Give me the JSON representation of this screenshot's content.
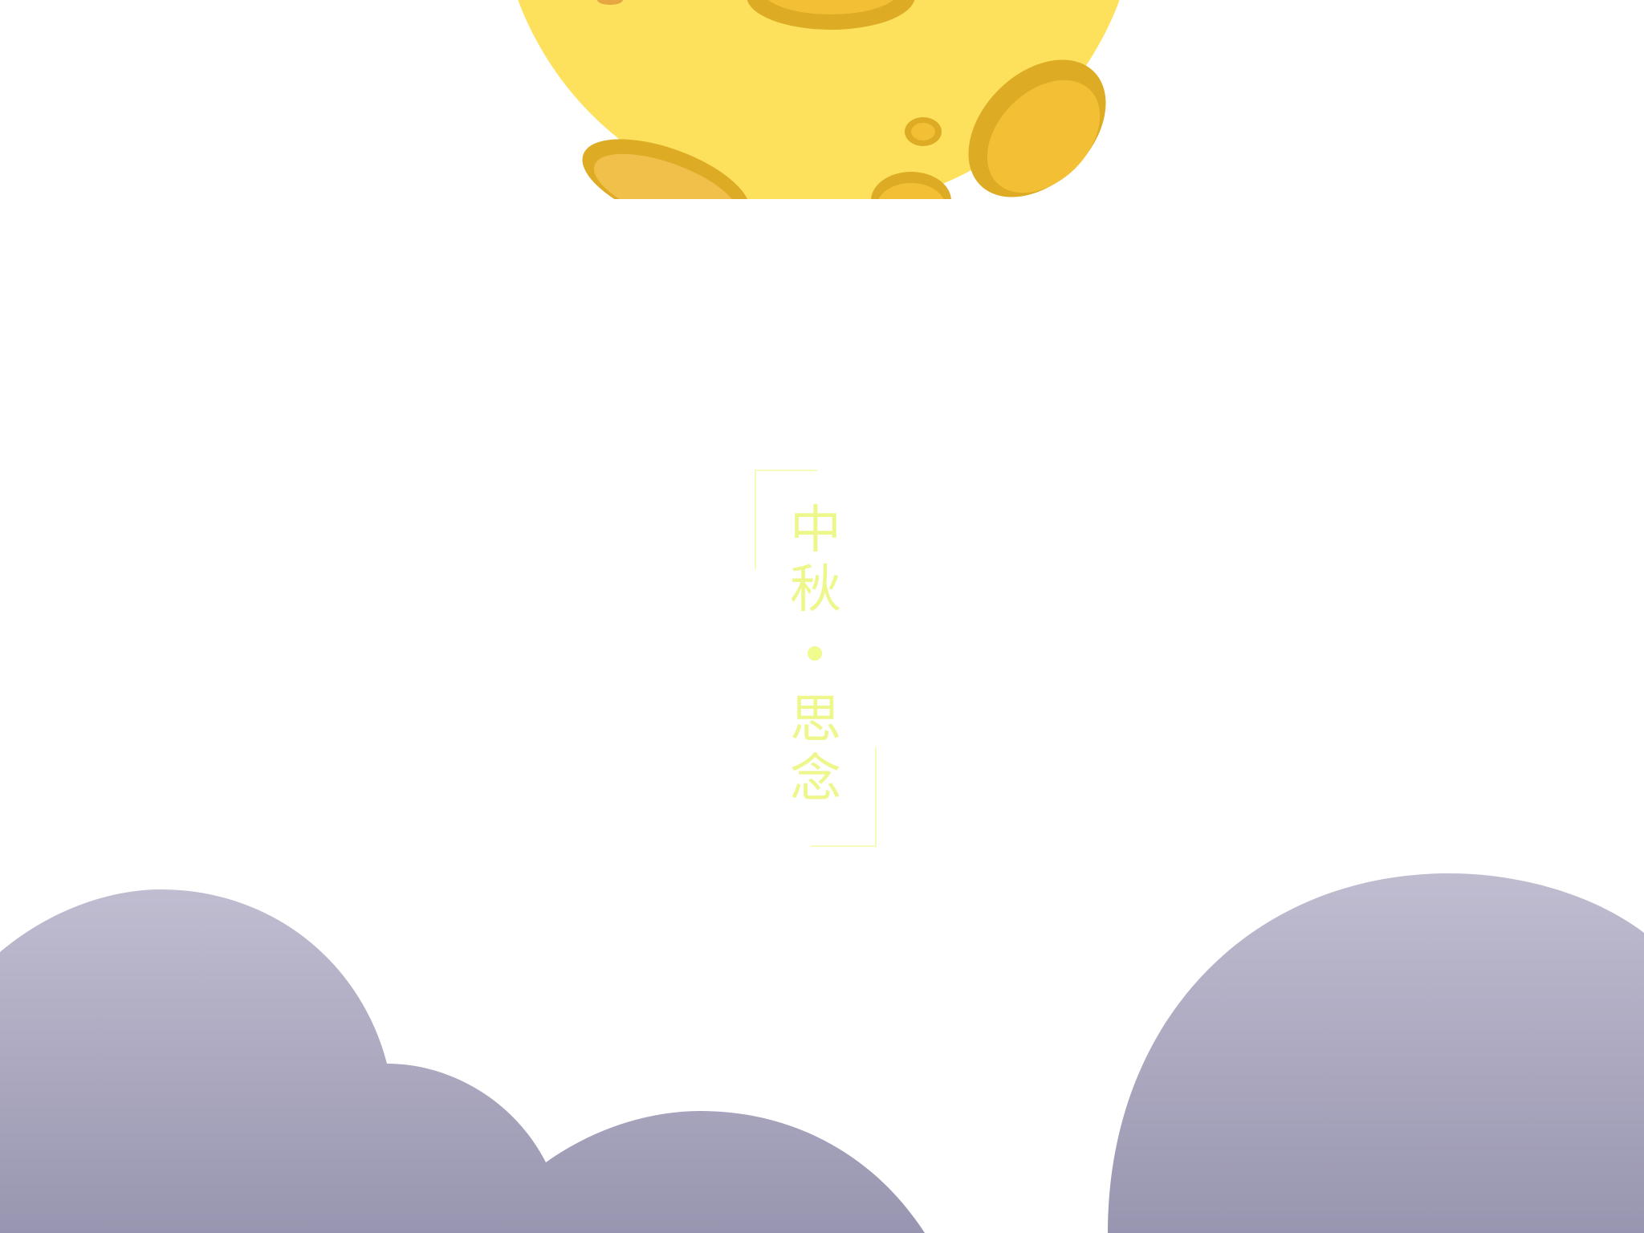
{
  "card": {
    "title_top": [
      "中",
      "秋"
    ],
    "title_bottom": [
      "思",
      "念"
    ],
    "separator_icon": "dot-icon"
  },
  "colors": {
    "background": "#ffffff",
    "moon": "#fde15d",
    "crater": "#f2bf35",
    "crater_rim": "#ddab24",
    "title": "#eef78c",
    "bracket": "#f6fbb9",
    "cloud_top": "#c0bdd1",
    "cloud_bottom": "#9895b0"
  }
}
